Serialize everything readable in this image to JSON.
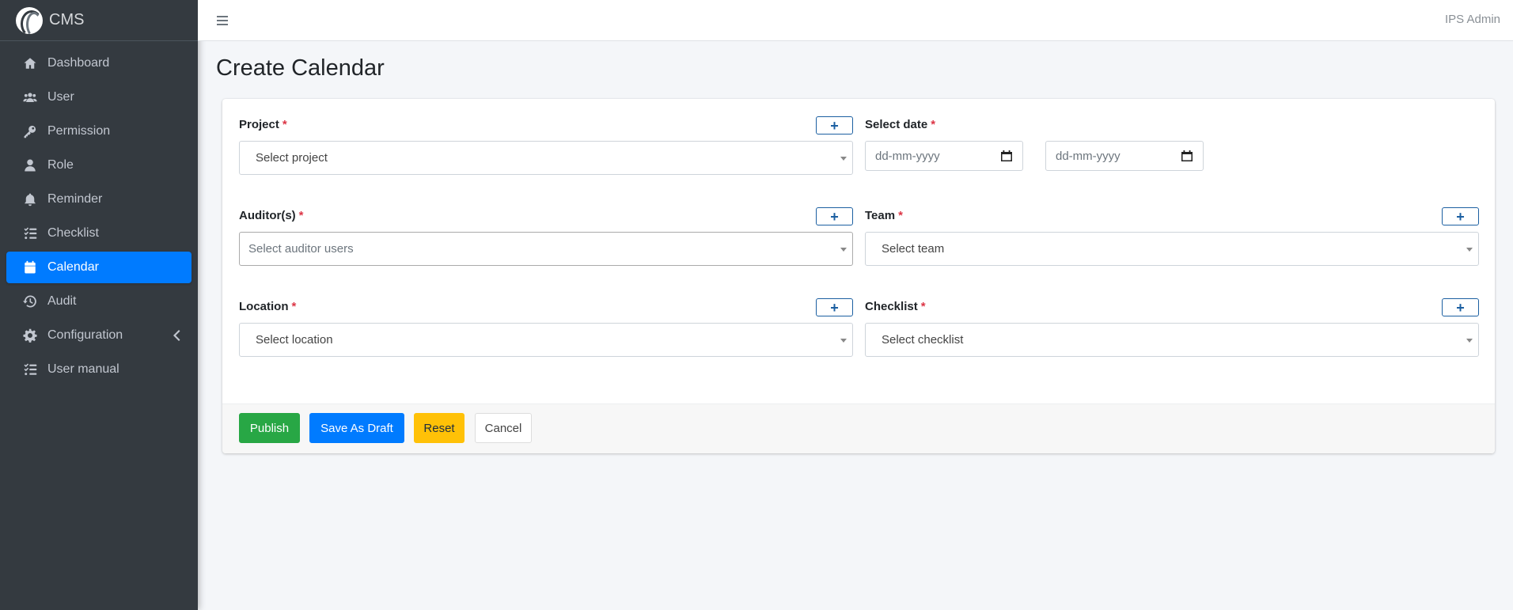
{
  "brand": {
    "name": "CMS"
  },
  "sidebar": {
    "items": [
      {
        "label": "Dashboard",
        "icon": "home-icon"
      },
      {
        "label": "User",
        "icon": "users-icon"
      },
      {
        "label": "Permission",
        "icon": "key-icon"
      },
      {
        "label": "Role",
        "icon": "user-icon"
      },
      {
        "label": "Reminder",
        "icon": "bell-icon"
      },
      {
        "label": "Checklist",
        "icon": "list-check-icon"
      },
      {
        "label": "Calendar",
        "icon": "calendar-icon",
        "active": true
      },
      {
        "label": "Audit",
        "icon": "history-icon"
      },
      {
        "label": "Configuration",
        "icon": "gear-icon",
        "expandable": true
      },
      {
        "label": "User manual",
        "icon": "list-check-icon"
      }
    ]
  },
  "topbar": {
    "user": "IPS Admin"
  },
  "page": {
    "title": "Create Calendar"
  },
  "form": {
    "required_mark": "*",
    "add_symbol": "+",
    "project": {
      "label": "Project",
      "placeholder": "Select project"
    },
    "select_date": {
      "label": "Select date",
      "start_placeholder": "dd-mm-yyyy",
      "end_placeholder": "dd-mm-yyyy"
    },
    "auditors": {
      "label": "Auditor(s)",
      "placeholder": "Select auditor users"
    },
    "team": {
      "label": "Team",
      "placeholder": "Select team"
    },
    "location": {
      "label": "Location",
      "placeholder": "Select location"
    },
    "checklist": {
      "label": "Checklist",
      "placeholder": "Select checklist"
    }
  },
  "actions": {
    "publish": "Publish",
    "save_draft": "Save As Draft",
    "reset": "Reset",
    "cancel": "Cancel"
  },
  "colors": {
    "sidebar_bg": "#343a40",
    "active": "#007bff",
    "publish": "#28a745",
    "reset": "#ffc107",
    "required": "#dc3545"
  }
}
